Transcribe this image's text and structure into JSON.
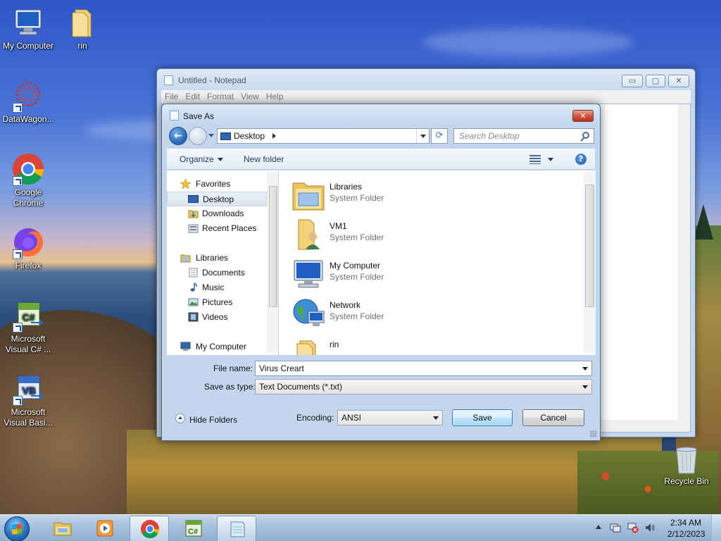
{
  "desktop": {
    "icons": [
      {
        "label": "My Computer",
        "icon": "computer-icon"
      },
      {
        "label": "rin",
        "icon": "folder-icon"
      },
      {
        "label": "DataWagon...",
        "icon": "datawagon-icon"
      },
      {
        "label": "Google Chrome",
        "label_line1": "Google",
        "label_line2": "Chrome",
        "icon": "chrome-icon"
      },
      {
        "label": "Firefox",
        "icon": "firefox-icon"
      },
      {
        "label": "Microsoft Visual C# ...",
        "label_line1": "Microsoft",
        "label_line2": "Visual C# ...",
        "icon": "visual-csharp-icon"
      },
      {
        "label": "Microsoft Visual Basi...",
        "label_line1": "Microsoft",
        "label_line2": "Visual Basi...",
        "icon": "visual-basic-icon"
      },
      {
        "label": "Recycle Bin",
        "icon": "recycle-bin-icon"
      }
    ]
  },
  "notepad": {
    "title": "Untitled - Notepad",
    "menu": [
      "File",
      "Edit",
      "Format",
      "View",
      "Help"
    ],
    "buttons": {
      "minimize": "▭",
      "maximize": "▢",
      "close": "✕"
    }
  },
  "dialog": {
    "title": "Save As",
    "close": "✕",
    "address": {
      "location": "Desktop"
    },
    "search": {
      "placeholder": "Search Desktop"
    },
    "refresh": "⟳",
    "commands": {
      "organize": "Organize",
      "new_folder": "New folder",
      "help": "?"
    },
    "nav": {
      "favorites": "Favorites",
      "favorites_items": [
        "Desktop",
        "Downloads",
        "Recent Places"
      ],
      "libraries": "Libraries",
      "libraries_items": [
        "Documents",
        "Music",
        "Pictures",
        "Videos"
      ],
      "computer": "My Computer",
      "selected": "Desktop"
    },
    "files": [
      {
        "name": "Libraries",
        "type": "System Folder",
        "icon": "libraries-icon"
      },
      {
        "name": "VM1",
        "type": "System Folder",
        "icon": "user-folder-icon"
      },
      {
        "name": "My Computer",
        "type": "System Folder",
        "icon": "computer-icon"
      },
      {
        "name": "Network",
        "type": "System Folder",
        "icon": "network-icon"
      },
      {
        "name": "rin",
        "type": "",
        "icon": "folder-icon"
      }
    ],
    "form": {
      "file_name_label": "File name:",
      "file_name_value": "Virus Creart",
      "save_type_label": "Save as type:",
      "save_type_value": "Text Documents (*.txt)",
      "hide_folders": "Hide Folders",
      "encoding_label": "Encoding:",
      "encoding_value": "ANSI",
      "save_button": "Save",
      "cancel_button": "Cancel"
    }
  },
  "taskbar": {
    "pinned": [
      "explorer-icon",
      "media-player-icon",
      "chrome-icon",
      "visual-csharp-icon",
      "notepad-icon"
    ],
    "active": "notepad-icon",
    "clock": {
      "time": "2:34 AM",
      "date": "2/12/2023"
    }
  },
  "colors": {
    "accent": "#2a6db8",
    "taskbar": "#afc8e1",
    "dialog_frame": "#c3d6ee",
    "close_red": "#c0341c"
  }
}
